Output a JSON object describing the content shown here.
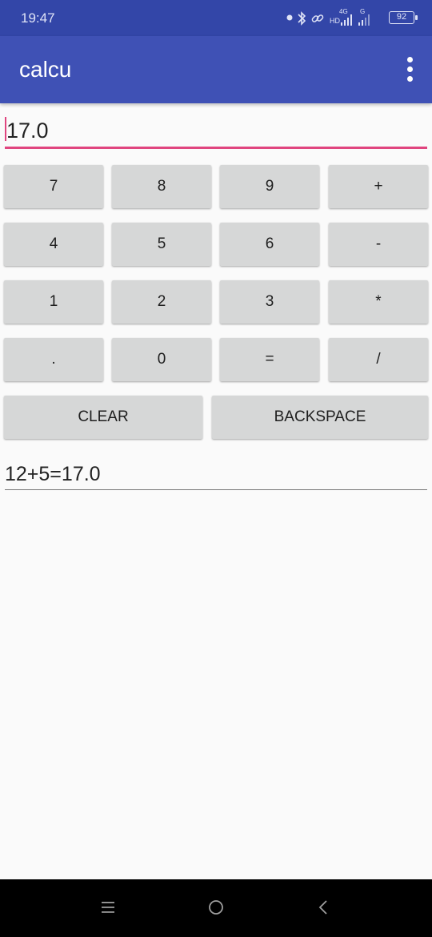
{
  "status_bar": {
    "time": "19:47",
    "network_label": "4G",
    "hd_label": "HD",
    "second_network_label": "G",
    "battery": "92",
    "icons": [
      "dot-icon",
      "bluetooth-icon",
      "link-icon",
      "signal-icon",
      "signal-icon",
      "battery-icon"
    ]
  },
  "app_bar": {
    "title": "calcu",
    "menu_icon": "more-vert-icon",
    "background": "#3f51b5"
  },
  "display": {
    "value": "17.0",
    "accent": "#e0457f"
  },
  "keypad": {
    "rows": [
      [
        "7",
        "8",
        "9",
        "+"
      ],
      [
        "4",
        "5",
        "6",
        "-"
      ],
      [
        "1",
        "2",
        "3",
        "*"
      ],
      [
        ".",
        "0",
        "=",
        "/"
      ]
    ],
    "clear_label": "CLEAR",
    "backspace_label": "BACKSPACE"
  },
  "history": {
    "text": "12+5=17.0"
  },
  "nav_bar": {
    "icons": [
      "recents-icon",
      "home-icon",
      "back-icon"
    ]
  }
}
